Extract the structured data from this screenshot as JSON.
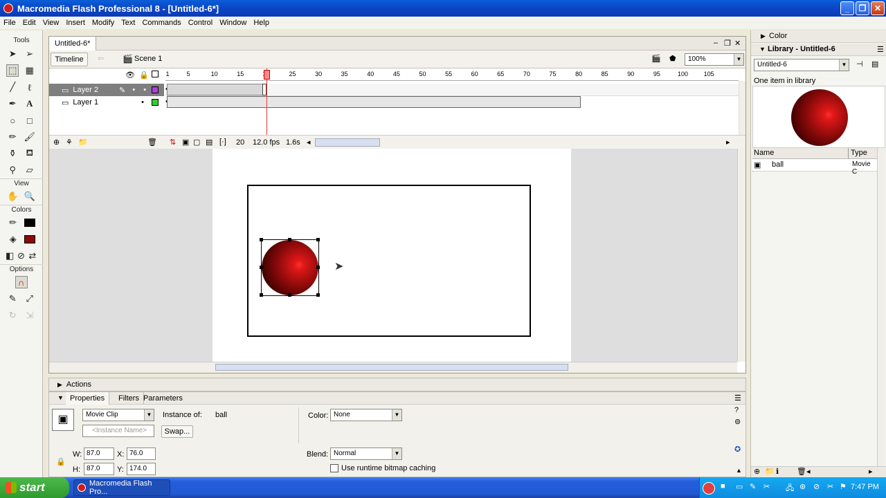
{
  "window": {
    "title": "Macromedia Flash Professional 8 - [Untitled-6*]"
  },
  "menu": [
    "File",
    "Edit",
    "View",
    "Insert",
    "Modify",
    "Text",
    "Commands",
    "Control",
    "Window",
    "Help"
  ],
  "tools": {
    "tools_label": "Tools",
    "view_label": "View",
    "colors_label": "Colors",
    "options_label": "Options"
  },
  "document": {
    "tab": "Untitled-6*",
    "timeline_button": "Timeline",
    "scene": "Scene 1",
    "zoom": "100%"
  },
  "timeline": {
    "ruler": [
      "1",
      "5",
      "10",
      "15",
      "20",
      "25",
      "30",
      "35",
      "40",
      "45",
      "50",
      "55",
      "60",
      "65",
      "70",
      "75",
      "80",
      "85",
      "90",
      "95",
      "100",
      "105"
    ],
    "layers": [
      {
        "name": "Layer 2",
        "color": "#b23ee0"
      },
      {
        "name": "Layer 1",
        "color": "#33cc33"
      }
    ],
    "current_frame": "20",
    "fps": "12.0 fps",
    "elapsed": "1.6s"
  },
  "actions": {
    "label": "Actions"
  },
  "properties": {
    "tabs": [
      "Properties",
      "Filters",
      "Parameters"
    ],
    "symbol_type": "Movie Clip",
    "instance_name_placeholder": "<Instance Name>",
    "instance_of_label": "Instance of:",
    "instance_of": "ball",
    "swap_label": "Swap...",
    "color_label": "Color:",
    "color_value": "None",
    "blend_label": "Blend:",
    "blend_value": "Normal",
    "cache_label": "Use runtime bitmap caching",
    "w_label": "W:",
    "w": "87.0",
    "x_label": "X:",
    "x": "76.0",
    "h_label": "H:",
    "h": "87.0",
    "y_label": "Y:",
    "y": "174.0"
  },
  "right_panel": {
    "color_label": "Color",
    "library_label": "Library - Untitled-6",
    "library_select": "Untitled-6",
    "item_count": "One item in library",
    "col_name": "Name",
    "col_type": "Type",
    "items": [
      {
        "name": "ball",
        "type": "Movie C"
      }
    ]
  },
  "taskbar": {
    "start": "start",
    "task": "Macromedia Flash Pro...",
    "clock": "7:47 PM"
  },
  "colors": {
    "ball": "#8b0a0a",
    "highlight": "#ff3030",
    "title_blue": "#0b47c7"
  }
}
